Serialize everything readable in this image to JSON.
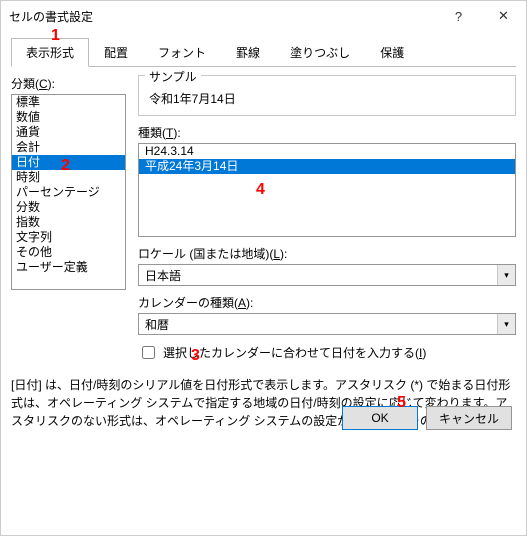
{
  "window": {
    "title": "セルの書式設定"
  },
  "tabs": [
    "表示形式",
    "配置",
    "フォント",
    "罫線",
    "塗りつぶし",
    "保護"
  ],
  "active_tab": 0,
  "category": {
    "label_pre": "分類(",
    "label_u": "C",
    "label_post": "):",
    "items": [
      "標準",
      "数値",
      "通貨",
      "会計",
      "日付",
      "時刻",
      "パーセンテージ",
      "分数",
      "指数",
      "文字列",
      "その他",
      "ユーザー定義"
    ],
    "selected": "日付"
  },
  "sample": {
    "legend": "サンプル",
    "value": "令和1年7月14日"
  },
  "type_list": {
    "label_pre": "種類(",
    "label_u": "T",
    "label_post": "):",
    "items": [
      "H24.3.14",
      "平成24年3月14日"
    ],
    "selected": "平成24年3月14日"
  },
  "locale": {
    "label_pre": "ロケール (国または地域)(",
    "label_u": "L",
    "label_post": "):",
    "value": "日本語"
  },
  "calendar_type": {
    "label_pre": "カレンダーの種類(",
    "label_u": "A",
    "label_post": "):",
    "value": "和暦"
  },
  "checkbox": {
    "label_pre": "選択したカレンダーに合わせて日付を入力する(",
    "label_u": "I",
    "label_post": ")",
    "checked": false
  },
  "description": "[日付] は、日付/時刻のシリアル値を日付形式で表示します。アスタリスク (*) で始まる日付形式は、オペレーティング システムで指定する地域の日付/時刻の設定に応じて変わります。アスタリスクのない形式は、オペレーティング システムの設定が変わってもそのままです。",
  "buttons": {
    "ok": "OK",
    "cancel": "キャンセル"
  },
  "annotations": {
    "a1": "1",
    "a2": "2",
    "a3": "3",
    "a4": "4",
    "a5": "5"
  }
}
